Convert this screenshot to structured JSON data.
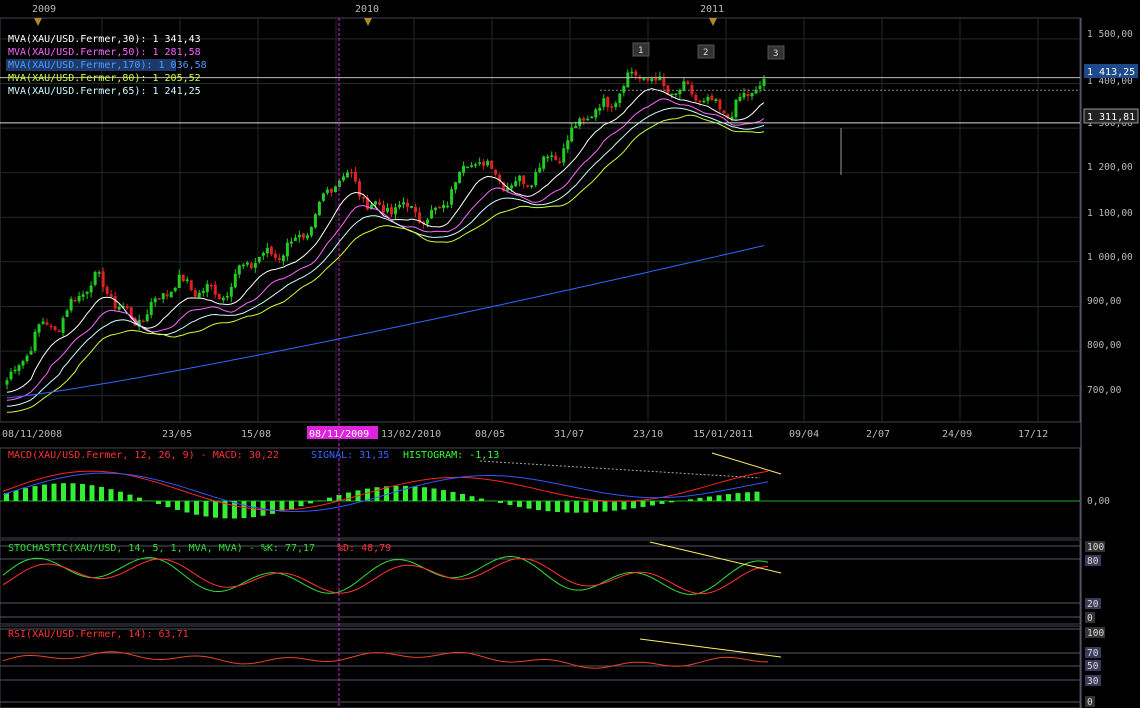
{
  "year_markers": [
    "2009",
    "2010",
    "2011"
  ],
  "wave_labels": [
    "1",
    "2",
    "3"
  ],
  "price_panel": {
    "legend": [
      {
        "text": "MVA(XAU/USD.Fermer,30): 1 341,43",
        "color": "#ffffff"
      },
      {
        "text": "MVA(XAU/USD.Fermer,50): 1 281,58",
        "color": "#ff66ff"
      },
      {
        "text": "MVA(XAU/USD.Fermer,170): 1 036,58",
        "color": "#3366ff"
      },
      {
        "text": "MVA(XAU/USD.Fermer,80): 1 205,52",
        "color": "#ccff33"
      },
      {
        "text": "MVA(XAU/USD.Fermer,65): 1 241,25",
        "color": "#ccffff"
      }
    ],
    "y_ticks": [
      "1 500,00",
      "1 400,00",
      "1 300,00",
      "1 200,00",
      "1 100,00",
      "1 000,00",
      "900,00",
      "800,00",
      "700,00"
    ],
    "last_price_label": "1 413,25",
    "line_price_label": "1 311,81"
  },
  "x_axis": {
    "labels": [
      "08/11/2008",
      "23/05",
      "15/08",
      "08/11/2009",
      "13/02/2010",
      "08/05",
      "31/07",
      "23/10",
      "15/01/2011",
      "09/04",
      "2/07",
      "24/09",
      "17/12"
    ],
    "highlighted": "08/11/2009"
  },
  "macd_panel": {
    "legend_red": "MACD(XAU/USD.Fermer, 12, 26, 9) - MACD: 30,22",
    "legend_blue": "SIGNAL: 31,35",
    "legend_green": "HISTOGRAM: -1,13",
    "zero_label": "0,00"
  },
  "stoch_panel": {
    "legend_green": "STOCHASTIC(XAU/USD, 14, 5, 1, MVA, MVA) - %K: 77,17",
    "legend_red": "%D: 48,79",
    "levels": [
      "100",
      "80",
      "20",
      "0"
    ]
  },
  "rsi_panel": {
    "legend": "RSI(XAU/USD.Fermer, 14): 63,71",
    "levels": [
      "100",
      "70",
      "50",
      "30",
      "0"
    ]
  },
  "colors": {
    "up": "#22cc22",
    "down": "#dd2222",
    "grid": "#1f2a2a",
    "axis_text": "#bbbbbb",
    "highlight": "#dd22dd",
    "trendline": "#ffee66",
    "year_marker": "#b08a20"
  },
  "chart_data": {
    "type": "line",
    "title": "",
    "instrument": "XAU/USD",
    "ylim": [
      650,
      1520
    ],
    "price_anchors": {
      "x": [
        "2008-11",
        "2009-01",
        "2009-02",
        "2009-04",
        "2009-06",
        "2009-08",
        "2009-09",
        "2009-10",
        "2009-11",
        "2009-12",
        "2010-02",
        "2010-05",
        "2010-07",
        "2010-08",
        "2010-10",
        "2010-11",
        "2010-12",
        "2011-01",
        "2011-02"
      ],
      "close": [
        735,
        860,
        950,
        880,
        940,
        940,
        1000,
        1060,
        1190,
        1120,
        1100,
        1220,
        1180,
        1230,
        1350,
        1410,
        1390,
        1330,
        1410
      ]
    },
    "series": [
      {
        "name": "MVA(XAU/USD.Fermer,30)",
        "last": 1341.43
      },
      {
        "name": "MVA(XAU/USD.Fermer,50)",
        "last": 1281.58
      },
      {
        "name": "MVA(XAU/USD.Fermer,170)",
        "last": 1036.58
      },
      {
        "name": "MVA(XAU/USD.Fermer,80)",
        "last": 1205.52
      },
      {
        "name": "MVA(XAU/USD.Fermer,65)",
        "last": 1241.25
      }
    ],
    "indicators": {
      "macd": {
        "macd": 30.22,
        "signal": 31.35,
        "histogram": -1.13
      },
      "stochastic": {
        "k": 77.17,
        "d": 48.79
      },
      "rsi": 63.71
    }
  }
}
